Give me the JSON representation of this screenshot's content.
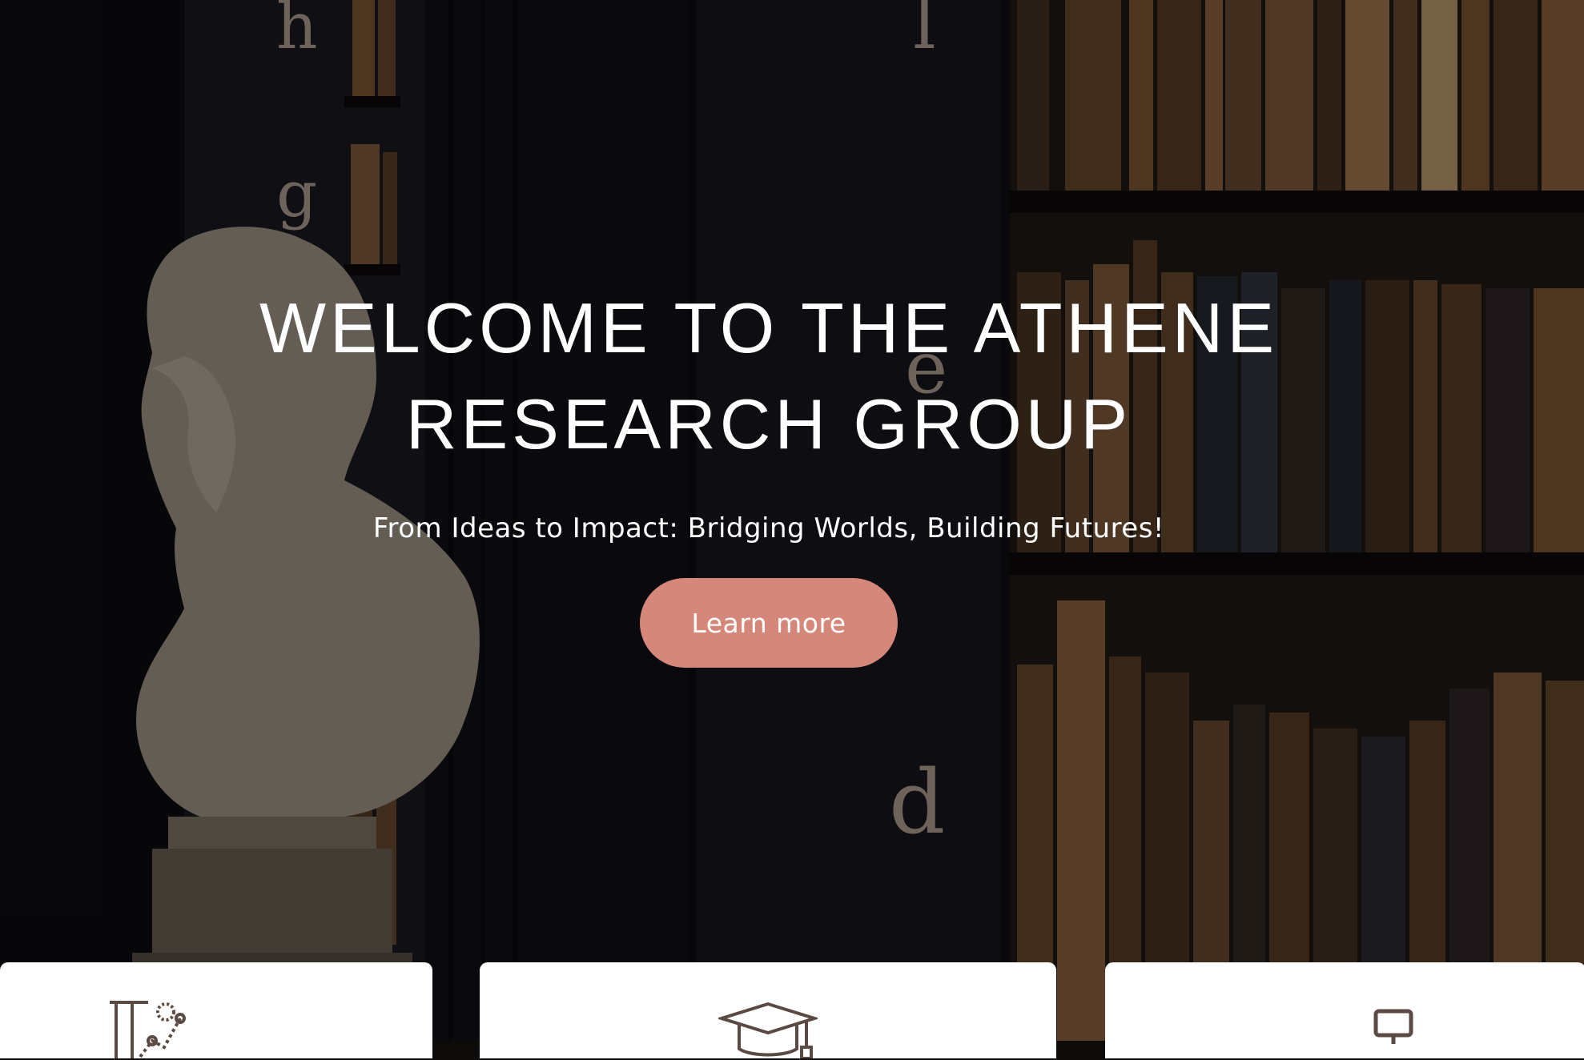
{
  "hero": {
    "title": "WELCOME TO THE ATHENE RESEARCH GROUP",
    "subtitle": "From Ideas to Impact: Bridging Worlds, Building Futures!",
    "button_label": "Learn more"
  },
  "cards": [
    {
      "icon": "research-chart-icon"
    },
    {
      "icon": "graduation-cap-icon"
    },
    {
      "icon": "monitor-icon"
    }
  ],
  "colors": {
    "accent": "#d5877a",
    "icon_stroke": "#5a4a42"
  }
}
